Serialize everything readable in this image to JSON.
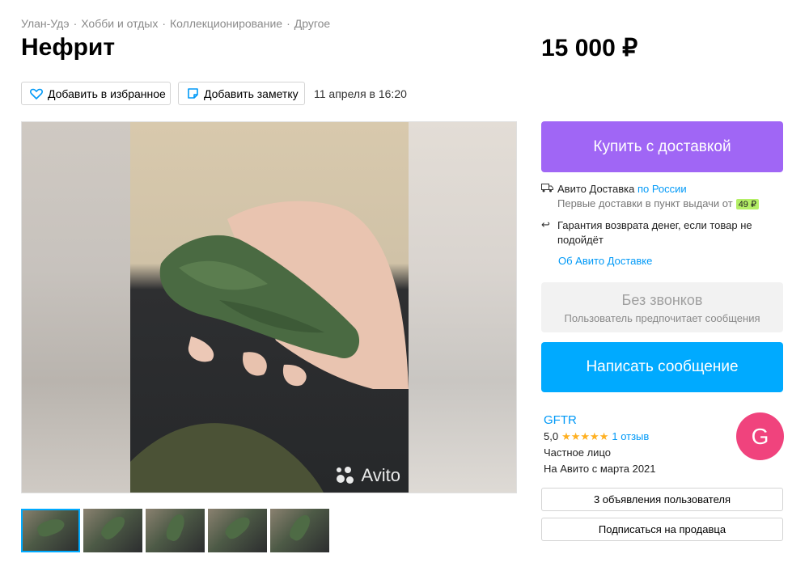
{
  "breadcrumb": [
    "Улан-Удэ",
    "Хобби и отдых",
    "Коллекционирование",
    "Другое"
  ],
  "breadcrumb_sep": "·",
  "title": "Нефрит",
  "price": "15 000 ₽",
  "actions": {
    "favorite": "Добавить в избранное",
    "note": "Добавить заметку",
    "date": "11 апреля в 16:20"
  },
  "gallery": {
    "watermark": "Avito",
    "thumb_count": 5
  },
  "buy_button": "Купить с доставкой",
  "delivery": {
    "line1_prefix": "Авито Доставка",
    "line1_link": "по России",
    "line2": "Первые доставки в пункт выдачи от",
    "badge": "49 ₽",
    "guarantee": "Гарантия возврата денег, если товар не подойдёт",
    "about_link": "Об Авито Доставке"
  },
  "no_calls": {
    "title": "Без звонков",
    "subtitle": "Пользователь предпочитает сообщения"
  },
  "message_button": "Написать сообщение",
  "seller": {
    "name": "GFTR",
    "rating": "5,0",
    "stars": "★★★★★",
    "reviews": "1 отзыв",
    "type": "Частное лицо",
    "since": "На Авито с марта 2021",
    "avatar_letter": "G"
  },
  "seller_listings": "3 объявления пользователя",
  "subscribe": "Подписаться на продавца",
  "colors": {
    "buy": "#a066f5",
    "message": "#00aaff",
    "avatar": "#f0437d",
    "link": "#0099f7",
    "star": "#ffb021"
  }
}
